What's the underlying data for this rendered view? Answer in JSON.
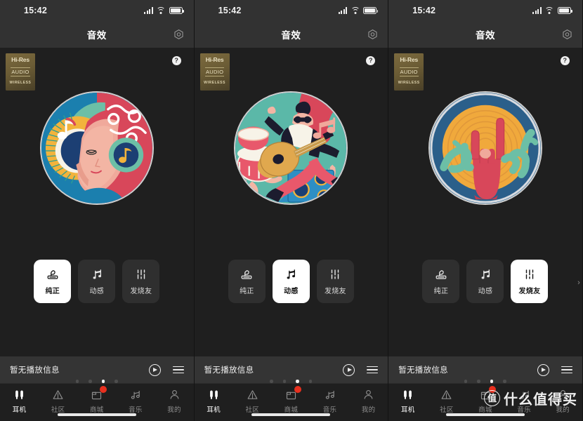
{
  "status": {
    "time": "15:42",
    "signal_icon": "cellular-signal-icon",
    "wifi_icon": "wifi-icon",
    "battery_icon": "battery-icon"
  },
  "navbar": {
    "title": "音效",
    "settings_icon": "gear-icon"
  },
  "badge": {
    "hires_line1": "Hi-Res",
    "hires_line2": "AUDIO",
    "hires_line3": "WIRELESS",
    "accent": "#b6a878"
  },
  "help": {
    "label": "?",
    "icon": "help-question-icon"
  },
  "modes": {
    "items": [
      {
        "label": "纯正",
        "icon": "gramophone-icon"
      },
      {
        "label": "动感",
        "icon": "music-note-icon"
      },
      {
        "label": "发烧友",
        "icon": "equalizer-sliders-icon"
      }
    ]
  },
  "pager": {
    "count": 4,
    "active_index": 2
  },
  "nowplaying": {
    "title": "暂无播放信息",
    "play_icon": "play-circle-icon",
    "playlist_icon": "playlist-icon"
  },
  "tabbar": {
    "items": [
      {
        "label": "耳机",
        "icon": "earbuds-icon",
        "active": true,
        "badge": false
      },
      {
        "label": "社区",
        "icon": "community-triangle-icon",
        "active": false,
        "badge": false
      },
      {
        "label": "商城",
        "icon": "shop-bag-icon",
        "active": false,
        "badge": true
      },
      {
        "label": "音乐",
        "icon": "music-note-icon",
        "active": false,
        "badge": false
      },
      {
        "label": "我的",
        "icon": "person-icon",
        "active": false,
        "badge": false
      }
    ],
    "badge_color": "#e8301f"
  },
  "panels": [
    {
      "active_mode": 0,
      "artwork": "woman-face-music-illustration"
    },
    {
      "active_mode": 1,
      "artwork": "guitarist-jumping-illustration"
    },
    {
      "active_mode": 2,
      "artwork": "rock-hand-tuber-illustration"
    }
  ],
  "watermark": {
    "logo": "值",
    "text": "什么值得买"
  },
  "colors": {
    "app_bg": "#1f1f1f",
    "bar_bg": "#323232",
    "nowplaying_bg": "#343434",
    "mode_bg": "#2f2f2f",
    "mode_active_bg": "#ffffff",
    "text": "#ffffff",
    "muted": "#8e8e8e"
  }
}
